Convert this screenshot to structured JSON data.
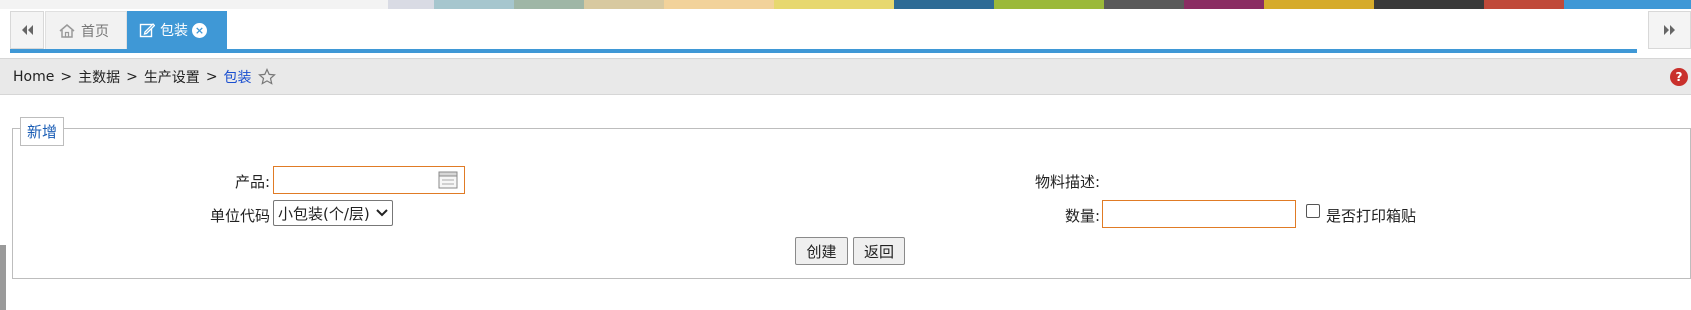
{
  "color_strip": [
    "#f3f3f3",
    "#d9dbe4",
    "#a6c6ce",
    "#9fb6a6",
    "#d8c9a0",
    "#f2d29a",
    "#e7d86f",
    "#2e6b95",
    "#9bb93a",
    "#5a5a5a",
    "#8a2c62",
    "#d6ab2b",
    "#3a3a3a",
    "#c04a3a",
    "#3f98d6"
  ],
  "tabs": {
    "home_label": "首页",
    "active_label": "包装",
    "active_close": "×"
  },
  "breadcrumb": {
    "home": "Home",
    "sep": ">",
    "level1": "主数据",
    "level2": "生产设置",
    "current": "包装"
  },
  "help": "?",
  "form": {
    "legend": "新增",
    "product_label": "产品:",
    "product_value": "",
    "material_desc_label": "物料描述:",
    "unit_code_label": "单位代码",
    "unit_code_value": "小包装(个/层)",
    "quantity_label": "数量:",
    "quantity_value": "",
    "print_label_checkbox_label": "是否打印箱贴",
    "print_label_checked": false,
    "create_button": "创建",
    "back_button": "返回"
  },
  "colors": {
    "accent": "#3f98d6",
    "input_border": "#e07b25",
    "breadcrumb_current": "#1a4fd0",
    "legend_text": "#1a5db5"
  }
}
